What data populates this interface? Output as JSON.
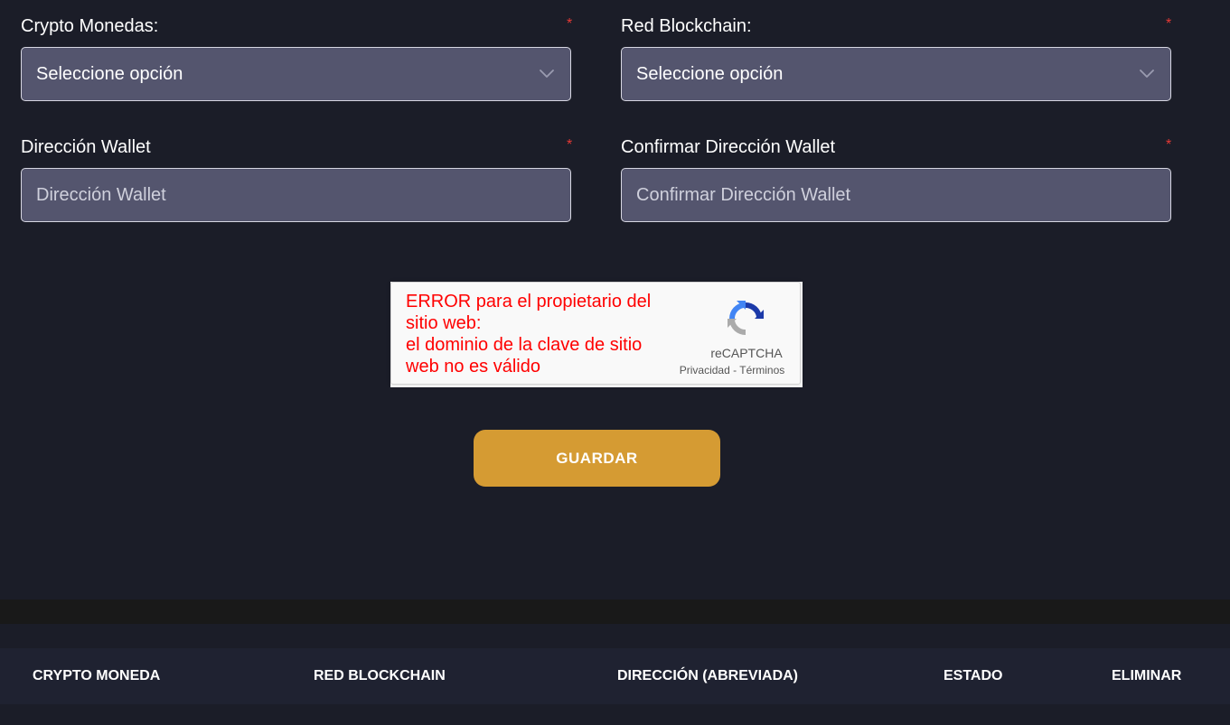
{
  "form": {
    "crypto": {
      "label": "Crypto Monedas:",
      "required_mark": "*",
      "selected": "Seleccione opción"
    },
    "network": {
      "label": "Red Blockchain:",
      "required_mark": "*",
      "selected": "Seleccione opción"
    },
    "wallet": {
      "label": "Dirección Wallet",
      "required_mark": "*",
      "placeholder": "Dirección Wallet",
      "value": ""
    },
    "wallet_confirm": {
      "label": "Confirmar Dirección Wallet",
      "required_mark": "*",
      "placeholder": "Confirmar Dirección Wallet",
      "value": ""
    }
  },
  "recaptcha": {
    "error_text": "ERROR para el propietario del sitio web:\nel dominio de la clave de sitio web no es válido",
    "brand": "reCAPTCHA",
    "privacy_link": "Privacidad",
    "separator": "-",
    "terms_link": "Términos"
  },
  "actions": {
    "save_label": "GUARDAR"
  },
  "table": {
    "columns": [
      "CRYPTO MONEDA",
      "RED BLOCKCHAIN",
      "DIRECCIÓN (ABREVIADA)",
      "ESTADO",
      "ELIMINAR"
    ]
  },
  "colors": {
    "background": "#1b1d28",
    "field_bg": "#54556e",
    "accent_button": "#d59b33",
    "required_mark": "#e53935",
    "recaptcha_error": "#ff0000",
    "table_header_bg": "#1f2231"
  },
  "icons": {
    "select_arrow": "chevron-down-icon",
    "recaptcha_logo": "recaptcha-logo-icon"
  }
}
